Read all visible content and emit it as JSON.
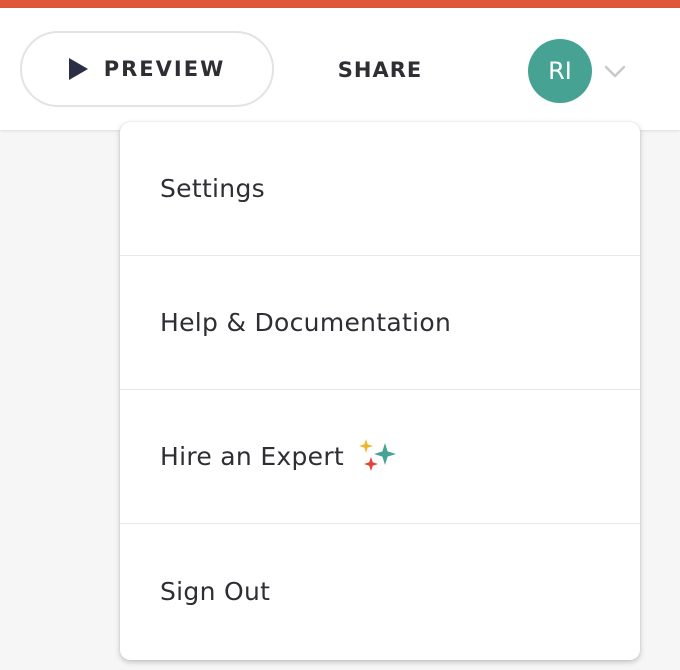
{
  "colors": {
    "accent_bar": "#e0563c",
    "avatar_bg": "#46a393",
    "sparkle_teal": "#46a393",
    "sparkle_yellow": "#f0b429",
    "sparkle_red": "#e0453a"
  },
  "header": {
    "preview": {
      "label": "PREVIEW",
      "icon": "play-icon"
    },
    "share_label": "SHARE",
    "avatar_initials": "RI",
    "menu_toggle_icon": "chevron-down-icon"
  },
  "menu": {
    "items": [
      {
        "label": "Settings"
      },
      {
        "label": "Help & Documentation"
      },
      {
        "label": "Hire an Expert",
        "icon": "sparkle-icon"
      },
      {
        "label": "Sign Out"
      }
    ]
  }
}
